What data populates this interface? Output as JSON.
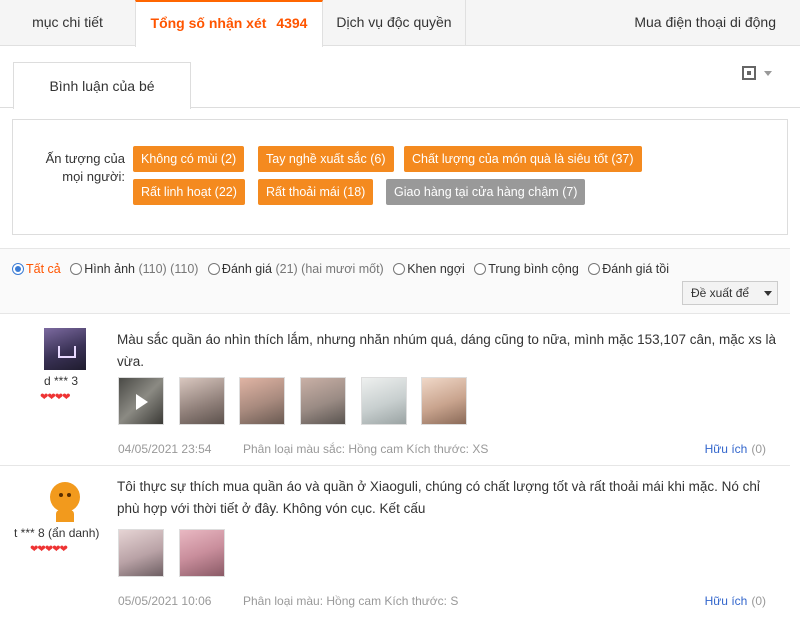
{
  "tabs": {
    "details": "mục chi tiết",
    "reviews_label": "Tổng số nhận xét",
    "reviews_count": "4394",
    "exclusive": "Dịch vụ độc quyền",
    "buy_phone": "Mua điện thoại di động"
  },
  "subtab": {
    "label": "Bình luận của bé"
  },
  "icons": {
    "qr": "qr-code-icon",
    "dropdown": "chevron-down-icon"
  },
  "impressions": {
    "label_line1": "Ấn tượng của",
    "label_line2": "mọi người:",
    "tags": [
      {
        "text": "Không có mùi (2)"
      },
      {
        "text": "Tay nghề xuất sắc (6)"
      },
      {
        "text": "Chất lượng của món quà là siêu tốt (37)"
      },
      {
        "text": "Rất linh hoạt (22)"
      },
      {
        "text": "Rất thoải mái (18)"
      },
      {
        "text": "Giao hàng tại cửa hàng chậm (7)"
      }
    ]
  },
  "filters": {
    "options": [
      {
        "label": "Tất cả",
        "count": "",
        "selected": true
      },
      {
        "label": "Hình ảnh",
        "count": "(110) (110)",
        "selected": false
      },
      {
        "label": "Đánh giá",
        "count": "(21) (hai mươi mốt)",
        "selected": false
      },
      {
        "label": "Khen ngợi",
        "count": "",
        "selected": false
      },
      {
        "label": "Trung bình cộng",
        "count": "",
        "selected": false
      },
      {
        "label": "Đánh giá tồi",
        "count": "",
        "selected": false
      }
    ],
    "sort_value": "Đề xuất để"
  },
  "reviews": [
    {
      "username": "d *** 3",
      "hearts": "❤❤❤❤",
      "text": "Màu sắc quần áo nhìn thích lắm, nhưng nhăn nhúm quá, dáng cũng to nữa, mình mặc 153,107 cân, mặc xs là vừa.",
      "date": "04/05/2021 23:54",
      "variant": "Phân loại màu sắc: Hồng cam Kích thước: XS",
      "useful_label": "Hữu ích",
      "useful_count": "(0)"
    },
    {
      "username": "t *** 8 (ẩn danh)",
      "hearts": "❤❤❤❤❤",
      "text": "Tôi thực sự thích mua quần áo và quần ở Xiaoguli, chúng có chất lượng tốt và rất thoải mái khi mặc. Nó chỉ phù hợp với thời tiết ở đây. Không vón cục. Kết cấu",
      "date": "05/05/2021 10:06",
      "variant": "Phân loại màu: Hồng cam Kích thước: S",
      "useful_label": "Hữu ích",
      "useful_count": "(0)"
    }
  ]
}
